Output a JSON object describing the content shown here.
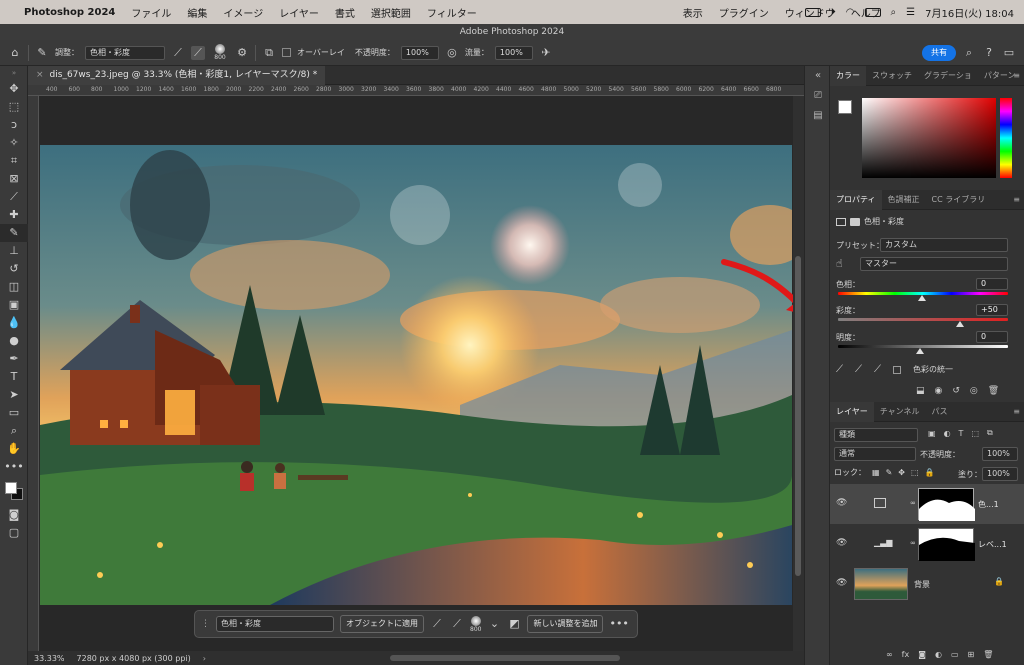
{
  "menubar": {
    "app_name": "Photoshop 2024",
    "items": [
      "ファイル",
      "編集",
      "イメージ",
      "レイヤー",
      "書式",
      "選択範囲",
      "フィルター"
    ],
    "right_items": [
      "表示",
      "プラグイン",
      "ウィンドウ",
      "ヘルプ"
    ],
    "clock": "7月16日(火)  18:04"
  },
  "window_title": "Adobe Photoshop 2024",
  "options": {
    "adjust_label": "調整：",
    "adjust_value": "色相・彩度",
    "brush_size": "800",
    "overlay_label": "オーバーレイ",
    "opacity_label": "不透明度：",
    "opacity_value": "100%",
    "flow_label": "流量：",
    "flow_value": "100%",
    "share_label": "共有"
  },
  "document": {
    "tab_label": "dis_67ws_23.jpeg @ 33.3% (色相・彩度1, レイヤーマスク/8) *",
    "close_glyph": "×",
    "ruler_ticks": [
      "400",
      "600",
      "800",
      "1000",
      "1200",
      "1400",
      "1600",
      "1800",
      "2000",
      "2200",
      "2400",
      "2600",
      "2800",
      "3000",
      "3200",
      "3400",
      "3600",
      "3800",
      "4000",
      "4200",
      "4400",
      "4600",
      "4800",
      "5000",
      "5200",
      "5400",
      "5600",
      "5800",
      "6000",
      "6200",
      "6400",
      "6600",
      "6800"
    ]
  },
  "taskbar": {
    "select_value": "色相・彩度",
    "apply_label": "オブジェクトに適用",
    "brush_size": "800",
    "new_adjust_label": "新しい調整を追加",
    "more": "•••"
  },
  "status": {
    "zoom": "33.33%",
    "doc_info": "7280 px x 4080 px (300 ppi)"
  },
  "color_panel": {
    "tabs": [
      "カラー",
      "スウォッチ",
      "グラデーショ",
      "パターン"
    ],
    "menu_glyph": "≡"
  },
  "properties_panel": {
    "tabs": [
      "プロパティ",
      "色調補正",
      "CC ライブラリ"
    ],
    "header": "色相・彩度",
    "preset_label": "プリセット：",
    "preset_value": "カスタム",
    "channel_value": "マスター",
    "hue_label": "色相：",
    "hue_value": "0",
    "saturation_label": "彩度：",
    "saturation_value": "+50",
    "lightness_label": "明度：",
    "lightness_value": "0",
    "colorize_label": "色彩の統一"
  },
  "layers_panel": {
    "tabs": [
      "レイヤー",
      "チャンネル",
      "パス"
    ],
    "filter_value": "種類",
    "blend_mode": "通常",
    "opacity_label": "不透明度：",
    "opacity_value": "100%",
    "lock_label": "ロック：",
    "fill_label": "塗り：",
    "fill_value": "100%",
    "layers": [
      {
        "name": "色...1"
      },
      {
        "name": "レベ...1"
      },
      {
        "name": "背景"
      }
    ]
  }
}
